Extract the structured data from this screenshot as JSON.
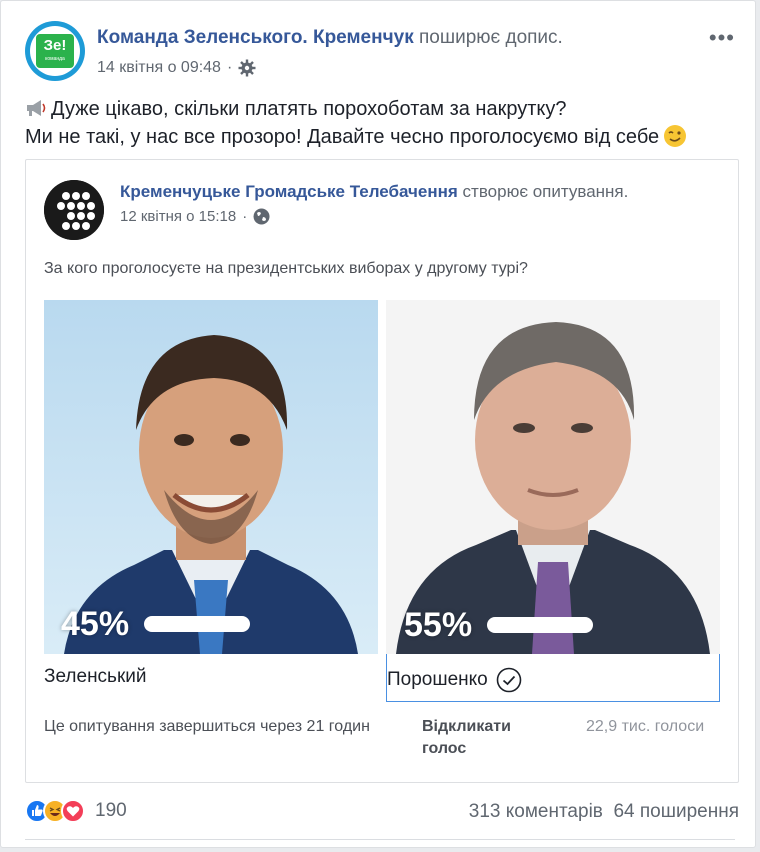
{
  "post": {
    "page_name": "Команда Зеленського. Кременчук",
    "action": "поширює допис.",
    "date": "14 квітня о 09:48",
    "separator": "·",
    "text_line1": "Дуже цікаво, скільки платять порохоботам за накрутку?",
    "text_line2": "Ми не такі, у нас все прозоро! Давайте чесно проголосуємо від себе",
    "avatar_logo": "Зе!",
    "avatar_sub": "команда",
    "more": "•••"
  },
  "shared": {
    "page_name": "Кременчуцьке Громадське Телебачення",
    "action": "створює опитування.",
    "date": "12 квітня о 15:18",
    "separator": "·"
  },
  "poll": {
    "question": "За кого проголосуєте на президентських виборах у другому турі?",
    "options": [
      {
        "label": "Зеленський",
        "percent": "45%",
        "share": 0.45,
        "selected": false
      },
      {
        "label": "Порошенко",
        "percent": "55%",
        "share": 0.55,
        "selected": true
      }
    ],
    "ends_text": "Це опитування завершиться через 21 годин",
    "revoke_label": "Відкликати голос",
    "votes_text": "22,9 тис. голоси"
  },
  "footer": {
    "reaction_count": "190",
    "comments": "313 коментарів",
    "shares": "64 поширення"
  },
  "colors": {
    "link": "#365899",
    "selected_border": "#4a90e2",
    "like": "#1877f2",
    "love": "#f33e58",
    "haha": "#f7b125"
  },
  "icons": [
    "gear-icon",
    "globe-icon",
    "megaphone-icon",
    "wink-icon",
    "check-circle-icon",
    "like-icon",
    "haha-icon",
    "love-icon",
    "more-icon"
  ]
}
